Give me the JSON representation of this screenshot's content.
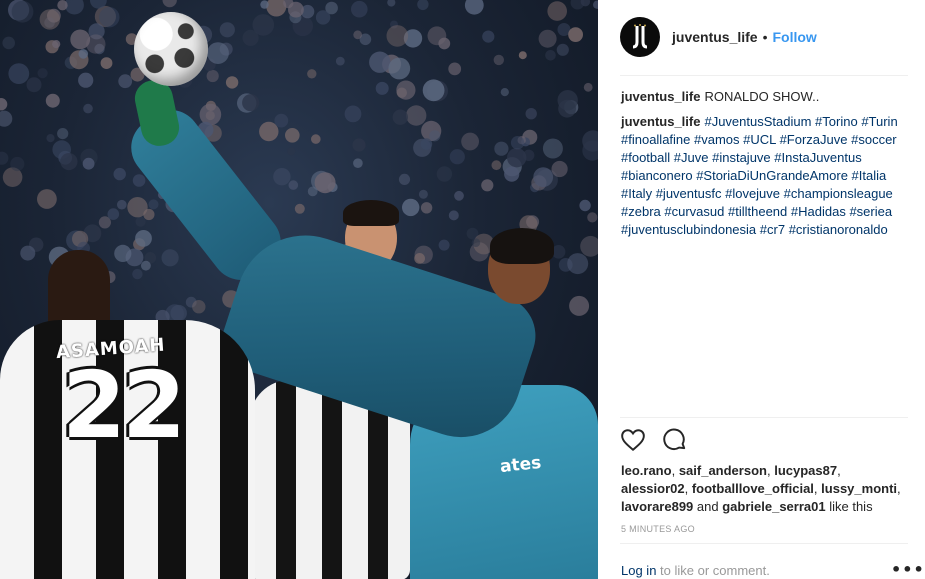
{
  "post": {
    "photo": {
      "shirt_name": "ASAMOAH",
      "shirt_number": "22",
      "sponsor_text": "ates"
    },
    "header": {
      "username": "juventus_life",
      "separator": "•",
      "follow_label": "Follow"
    },
    "caption": {
      "user": "juventus_life",
      "text": "RONALDO SHOW.."
    },
    "comment": {
      "user": "juventus_life",
      "hashtags": [
        "#JuventusStadium",
        "#Torino",
        "#Turin",
        "#finoallafine",
        "#vamos",
        "#UCL",
        "#ForzaJuve",
        "#soccer",
        "#football",
        "#Juve",
        "#instajuve",
        "#InstaJuventus",
        "#bianconero",
        "#StoriaDiUnGrandeAmore",
        "#Italia",
        "#Italy",
        "#juventusfc",
        "#lovejuve",
        "#championsleague",
        "#zebra",
        "#curvasud",
        "#tilltheend",
        "#Hadidas",
        "#seriea",
        "#juventusclubindonesia",
        "#cr7",
        "#cristianoronaldo"
      ]
    },
    "actions": {
      "like_icon": "heart-icon",
      "comment_icon": "comment-bubble-icon"
    },
    "likes": {
      "users_line1": [
        "leo.rano",
        "saif_anderson",
        "lucypas87"
      ],
      "users_line2": [
        "alessior02",
        "footballlove_official",
        "lussy_monti"
      ],
      "users_line3": [
        "lavorare899"
      ],
      "and_text": "and",
      "last_user": "gabriele_serra01",
      "suffix": "like this"
    },
    "timestamp": "5 MINUTES AGO",
    "login": {
      "link_text": "Log in",
      "rest_text": "to like or comment."
    },
    "more_icon": "more-options-icon",
    "more_label": "•••"
  },
  "colors": {
    "link": "#003569",
    "follow": "#3897f0",
    "muted": "#999999",
    "divider": "#efefef",
    "text": "#262626"
  }
}
